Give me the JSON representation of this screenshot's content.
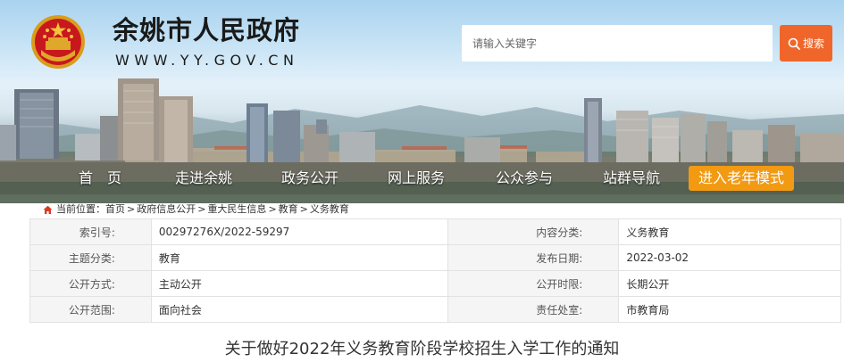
{
  "header": {
    "site_title": "余姚市人民政府",
    "site_domain": "WWW.YY.GOV.CN",
    "emblem_icon": "national-emblem-icon",
    "search": {
      "placeholder": "请输入关键字",
      "value": "",
      "button_label": "搜索",
      "button_icon": "search-icon",
      "button_color": "#f0662a"
    }
  },
  "nav": {
    "items": [
      {
        "label": "首　页"
      },
      {
        "label": "走进余姚"
      },
      {
        "label": "政务公开"
      },
      {
        "label": "网上服务"
      },
      {
        "label": "公众参与"
      },
      {
        "label": "站群导航"
      }
    ],
    "elder_mode_label": "进入老年模式",
    "elder_mode_color": "#f19a12"
  },
  "breadcrumb": {
    "prefix": "当前位置：",
    "home_icon": "home-icon",
    "items": [
      {
        "label": "首页"
      },
      {
        "label": "政府信息公开"
      },
      {
        "label": "重大民生信息"
      },
      {
        "label": "教育"
      },
      {
        "label": "义务教育"
      }
    ],
    "separator": ">"
  },
  "info_table": {
    "rows": [
      [
        {
          "key": "索引号:",
          "value": "00297276X/2022-59297"
        },
        {
          "key": "内容分类:",
          "value": "义务教育"
        }
      ],
      [
        {
          "key": "主题分类:",
          "value": "教育"
        },
        {
          "key": "发布日期:",
          "value": "2022-03-02"
        }
      ],
      [
        {
          "key": "公开方式:",
          "value": "主动公开"
        },
        {
          "key": "公开时限:",
          "value": "长期公开"
        }
      ],
      [
        {
          "key": "公开范围:",
          "value": "面向社会"
        },
        {
          "key": "责任处室:",
          "value": "市教育局"
        }
      ]
    ]
  },
  "article": {
    "title": "关于做好2022年义务教育阶段学校招生入学工作的通知"
  }
}
